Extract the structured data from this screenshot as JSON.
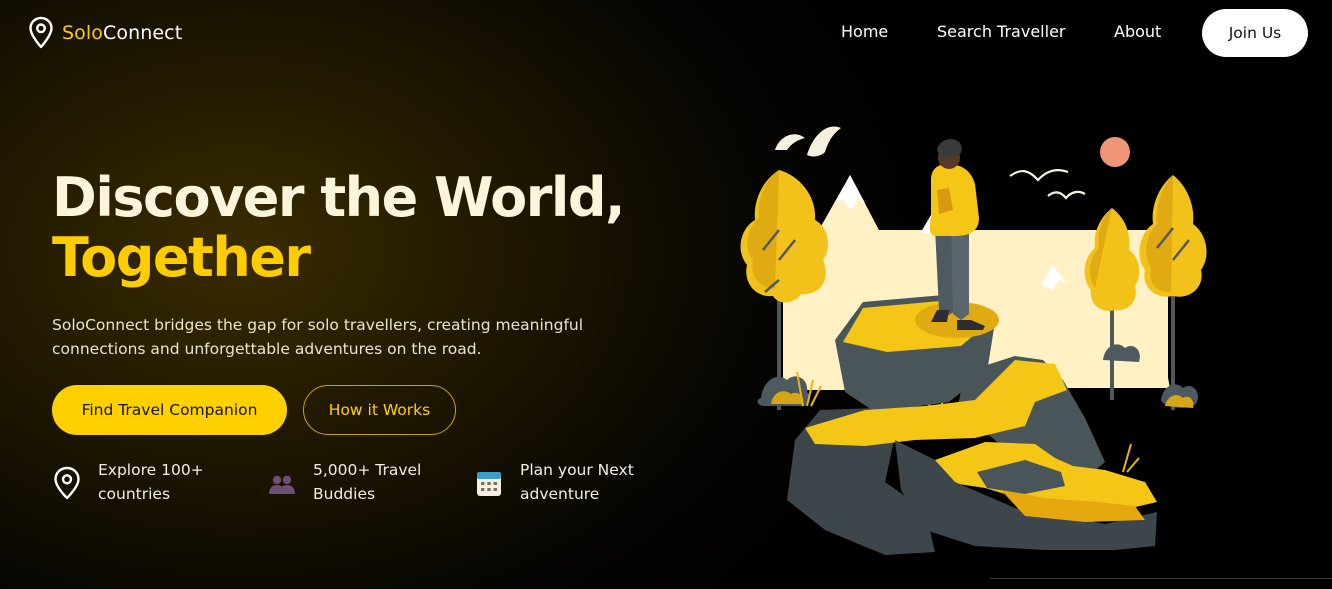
{
  "brand": {
    "name_part1": "Solo",
    "name_part2": "Connect"
  },
  "nav": {
    "links": [
      {
        "label": "Home"
      },
      {
        "label": "Search Traveller"
      },
      {
        "label": "About"
      }
    ],
    "cta_label": "Join Us"
  },
  "hero": {
    "headline_line1": "Discover the World,",
    "headline_line2": "Together",
    "subtext": "SoloConnect bridges the gap for solo travellers, creating meaningful connections and unforgettable adventures on the road.",
    "primary_button": "Find Travel Companion",
    "secondary_button": "How it Works"
  },
  "features": [
    {
      "icon": "map-pin-icon",
      "text_line1": "Explore 100+",
      "text_line2": "countries"
    },
    {
      "icon": "people-icon",
      "text_line1": "5,000+ Travel",
      "text_line2": "Buddies"
    },
    {
      "icon": "calendar-icon",
      "text_line1": "Plan your Next",
      "text_line2": "adventure"
    }
  ],
  "colors": {
    "accent": "#ffcc00",
    "background": "#000000",
    "headline": "#fbf5dc"
  }
}
